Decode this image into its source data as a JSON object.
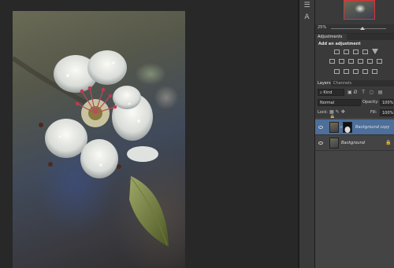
{
  "canvas": {
    "image_subject": "white blossom with water droplets"
  },
  "navigator": {
    "zoom": "25%"
  },
  "adjustments": {
    "tab_label": "Adjustments",
    "title": "Add an adjustment"
  },
  "layers": {
    "tab_label": "Layers",
    "channels_label": "Channels",
    "kind_label": "Kind",
    "blend_mode": "Normal",
    "opacity_label": "Opacity:",
    "opacity_value": "100%",
    "lock_label": "Lock:",
    "fill_label": "Fill:",
    "fill_value": "100%",
    "items": [
      {
        "name": "Background copy",
        "selected": true,
        "has_mask": true,
        "locked": false
      },
      {
        "name": "Background",
        "selected": false,
        "has_mask": false,
        "locked": true
      }
    ]
  },
  "colors": {
    "app_background": "#282828",
    "panel": "#3a3a3a",
    "selected_layer": "#4d6f9a",
    "nav_frame": "#dd3333"
  }
}
